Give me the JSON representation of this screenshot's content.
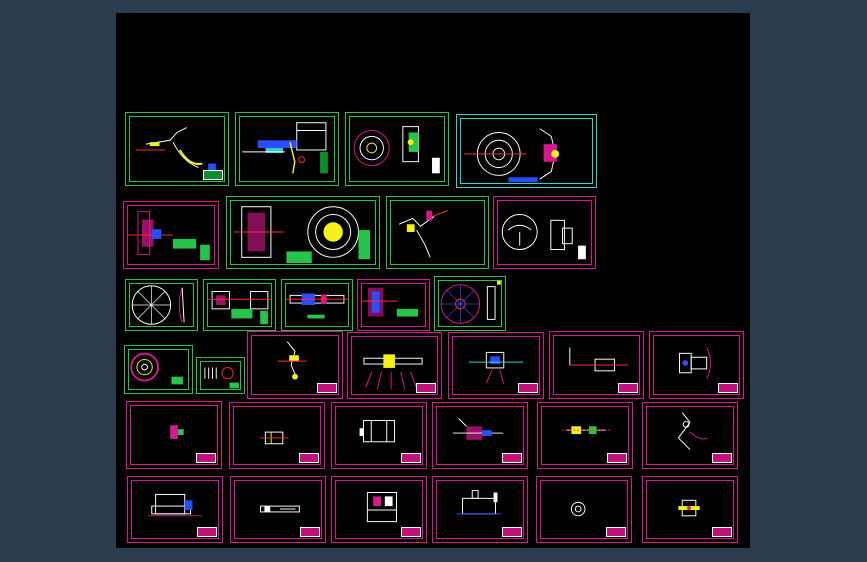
{
  "viewer": {
    "background_color": "#2b3c4e",
    "canvas_color": "#000000"
  },
  "colors": {
    "frame_magenta": "#d8188f",
    "frame_green": "#27c34a",
    "frame_cyan": "#2ad5cf",
    "line_white": "#ffffff",
    "line_yellow": "#f2f21a",
    "line_red": "#ff2a2a",
    "line_blue": "#2a4dff"
  },
  "drawing_sheets": [
    {
      "id": "r1-1",
      "frame": "green",
      "icon": "pedal-assembly-icon"
    },
    {
      "id": "r1-2",
      "frame": "green",
      "icon": "gearbox-section-icon"
    },
    {
      "id": "r1-3",
      "frame": "green",
      "icon": "clutch-disc-view-icon"
    },
    {
      "id": "r1-4",
      "frame": "cyan",
      "icon": "flywheel-housing-icon"
    },
    {
      "id": "r2-1",
      "frame": "magenta",
      "icon": "clutch-section-icon"
    },
    {
      "id": "r2-2",
      "frame": "green",
      "icon": "pressure-plate-icon"
    },
    {
      "id": "r2-3",
      "frame": "green",
      "icon": "release-lever-icon"
    },
    {
      "id": "r2-4",
      "frame": "magenta",
      "icon": "cover-plate-icon"
    },
    {
      "id": "r3-1",
      "frame": "green",
      "icon": "driven-disc-icon"
    },
    {
      "id": "r3-2",
      "frame": "green",
      "icon": "hub-section-icon"
    },
    {
      "id": "r3-3",
      "frame": "green",
      "icon": "shaft-icon"
    },
    {
      "id": "r3-4",
      "frame": "green",
      "icon": "spline-hub-icon"
    },
    {
      "id": "r3-5",
      "frame": "green",
      "icon": "friction-plate-icon"
    },
    {
      "id": "r4-1",
      "frame": "green",
      "icon": "disc-spring-icon"
    },
    {
      "id": "r4-2",
      "frame": "green",
      "icon": "spring-detail-icon"
    },
    {
      "id": "r4-3",
      "frame": "magenta",
      "icon": "fork-icon"
    },
    {
      "id": "r4-4",
      "frame": "magenta",
      "icon": "release-shaft-icon"
    },
    {
      "id": "r4-5",
      "frame": "magenta",
      "icon": "bracket-icon"
    },
    {
      "id": "r4-6",
      "frame": "magenta",
      "icon": "bearing-sleeve-icon"
    },
    {
      "id": "r4-7",
      "frame": "magenta",
      "icon": "housing-bracket-icon"
    },
    {
      "id": "r5-1",
      "frame": "magenta",
      "icon": "pin-icon"
    },
    {
      "id": "r5-2",
      "frame": "magenta",
      "icon": "bushing-icon"
    },
    {
      "id": "r5-3",
      "frame": "magenta",
      "icon": "cylinder-icon"
    },
    {
      "id": "r5-4",
      "frame": "magenta",
      "icon": "piston-icon"
    },
    {
      "id": "r5-5",
      "frame": "magenta",
      "icon": "push-rod-icon"
    },
    {
      "id": "r5-6",
      "frame": "magenta",
      "icon": "lever-arm-icon"
    },
    {
      "id": "r6-1",
      "frame": "magenta",
      "icon": "master-cylinder-icon"
    },
    {
      "id": "r6-2",
      "frame": "magenta",
      "icon": "rod-icon"
    },
    {
      "id": "r6-3",
      "frame": "magenta",
      "icon": "block-icon"
    },
    {
      "id": "r6-4",
      "frame": "magenta",
      "icon": "reservoir-icon"
    },
    {
      "id": "r6-5",
      "frame": "magenta",
      "icon": "washer-icon"
    },
    {
      "id": "r6-6",
      "frame": "magenta",
      "icon": "fitting-icon"
    }
  ]
}
